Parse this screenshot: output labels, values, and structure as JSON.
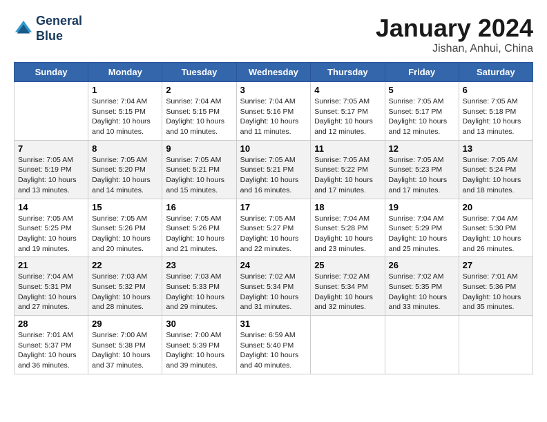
{
  "header": {
    "logo_line1": "General",
    "logo_line2": "Blue",
    "title": "January 2024",
    "subtitle": "Jishan, Anhui, China"
  },
  "days_of_week": [
    "Sunday",
    "Monday",
    "Tuesday",
    "Wednesday",
    "Thursday",
    "Friday",
    "Saturday"
  ],
  "weeks": [
    [
      {
        "date": "",
        "sunrise": "",
        "sunset": "",
        "daylight": ""
      },
      {
        "date": "1",
        "sunrise": "Sunrise: 7:04 AM",
        "sunset": "Sunset: 5:15 PM",
        "daylight": "Daylight: 10 hours and 10 minutes."
      },
      {
        "date": "2",
        "sunrise": "Sunrise: 7:04 AM",
        "sunset": "Sunset: 5:15 PM",
        "daylight": "Daylight: 10 hours and 10 minutes."
      },
      {
        "date": "3",
        "sunrise": "Sunrise: 7:04 AM",
        "sunset": "Sunset: 5:16 PM",
        "daylight": "Daylight: 10 hours and 11 minutes."
      },
      {
        "date": "4",
        "sunrise": "Sunrise: 7:05 AM",
        "sunset": "Sunset: 5:17 PM",
        "daylight": "Daylight: 10 hours and 12 minutes."
      },
      {
        "date": "5",
        "sunrise": "Sunrise: 7:05 AM",
        "sunset": "Sunset: 5:17 PM",
        "daylight": "Daylight: 10 hours and 12 minutes."
      },
      {
        "date": "6",
        "sunrise": "Sunrise: 7:05 AM",
        "sunset": "Sunset: 5:18 PM",
        "daylight": "Daylight: 10 hours and 13 minutes."
      }
    ],
    [
      {
        "date": "7",
        "sunrise": "Sunrise: 7:05 AM",
        "sunset": "Sunset: 5:19 PM",
        "daylight": "Daylight: 10 hours and 13 minutes."
      },
      {
        "date": "8",
        "sunrise": "Sunrise: 7:05 AM",
        "sunset": "Sunset: 5:20 PM",
        "daylight": "Daylight: 10 hours and 14 minutes."
      },
      {
        "date": "9",
        "sunrise": "Sunrise: 7:05 AM",
        "sunset": "Sunset: 5:21 PM",
        "daylight": "Daylight: 10 hours and 15 minutes."
      },
      {
        "date": "10",
        "sunrise": "Sunrise: 7:05 AM",
        "sunset": "Sunset: 5:21 PM",
        "daylight": "Daylight: 10 hours and 16 minutes."
      },
      {
        "date": "11",
        "sunrise": "Sunrise: 7:05 AM",
        "sunset": "Sunset: 5:22 PM",
        "daylight": "Daylight: 10 hours and 17 minutes."
      },
      {
        "date": "12",
        "sunrise": "Sunrise: 7:05 AM",
        "sunset": "Sunset: 5:23 PM",
        "daylight": "Daylight: 10 hours and 17 minutes."
      },
      {
        "date": "13",
        "sunrise": "Sunrise: 7:05 AM",
        "sunset": "Sunset: 5:24 PM",
        "daylight": "Daylight: 10 hours and 18 minutes."
      }
    ],
    [
      {
        "date": "14",
        "sunrise": "Sunrise: 7:05 AM",
        "sunset": "Sunset: 5:25 PM",
        "daylight": "Daylight: 10 hours and 19 minutes."
      },
      {
        "date": "15",
        "sunrise": "Sunrise: 7:05 AM",
        "sunset": "Sunset: 5:26 PM",
        "daylight": "Daylight: 10 hours and 20 minutes."
      },
      {
        "date": "16",
        "sunrise": "Sunrise: 7:05 AM",
        "sunset": "Sunset: 5:26 PM",
        "daylight": "Daylight: 10 hours and 21 minutes."
      },
      {
        "date": "17",
        "sunrise": "Sunrise: 7:05 AM",
        "sunset": "Sunset: 5:27 PM",
        "daylight": "Daylight: 10 hours and 22 minutes."
      },
      {
        "date": "18",
        "sunrise": "Sunrise: 7:04 AM",
        "sunset": "Sunset: 5:28 PM",
        "daylight": "Daylight: 10 hours and 23 minutes."
      },
      {
        "date": "19",
        "sunrise": "Sunrise: 7:04 AM",
        "sunset": "Sunset: 5:29 PM",
        "daylight": "Daylight: 10 hours and 25 minutes."
      },
      {
        "date": "20",
        "sunrise": "Sunrise: 7:04 AM",
        "sunset": "Sunset: 5:30 PM",
        "daylight": "Daylight: 10 hours and 26 minutes."
      }
    ],
    [
      {
        "date": "21",
        "sunrise": "Sunrise: 7:04 AM",
        "sunset": "Sunset: 5:31 PM",
        "daylight": "Daylight: 10 hours and 27 minutes."
      },
      {
        "date": "22",
        "sunrise": "Sunrise: 7:03 AM",
        "sunset": "Sunset: 5:32 PM",
        "daylight": "Daylight: 10 hours and 28 minutes."
      },
      {
        "date": "23",
        "sunrise": "Sunrise: 7:03 AM",
        "sunset": "Sunset: 5:33 PM",
        "daylight": "Daylight: 10 hours and 29 minutes."
      },
      {
        "date": "24",
        "sunrise": "Sunrise: 7:02 AM",
        "sunset": "Sunset: 5:34 PM",
        "daylight": "Daylight: 10 hours and 31 minutes."
      },
      {
        "date": "25",
        "sunrise": "Sunrise: 7:02 AM",
        "sunset": "Sunset: 5:34 PM",
        "daylight": "Daylight: 10 hours and 32 minutes."
      },
      {
        "date": "26",
        "sunrise": "Sunrise: 7:02 AM",
        "sunset": "Sunset: 5:35 PM",
        "daylight": "Daylight: 10 hours and 33 minutes."
      },
      {
        "date": "27",
        "sunrise": "Sunrise: 7:01 AM",
        "sunset": "Sunset: 5:36 PM",
        "daylight": "Daylight: 10 hours and 35 minutes."
      }
    ],
    [
      {
        "date": "28",
        "sunrise": "Sunrise: 7:01 AM",
        "sunset": "Sunset: 5:37 PM",
        "daylight": "Daylight: 10 hours and 36 minutes."
      },
      {
        "date": "29",
        "sunrise": "Sunrise: 7:00 AM",
        "sunset": "Sunset: 5:38 PM",
        "daylight": "Daylight: 10 hours and 37 minutes."
      },
      {
        "date": "30",
        "sunrise": "Sunrise: 7:00 AM",
        "sunset": "Sunset: 5:39 PM",
        "daylight": "Daylight: 10 hours and 39 minutes."
      },
      {
        "date": "31",
        "sunrise": "Sunrise: 6:59 AM",
        "sunset": "Sunset: 5:40 PM",
        "daylight": "Daylight: 10 hours and 40 minutes."
      },
      {
        "date": "",
        "sunrise": "",
        "sunset": "",
        "daylight": ""
      },
      {
        "date": "",
        "sunrise": "",
        "sunset": "",
        "daylight": ""
      },
      {
        "date": "",
        "sunrise": "",
        "sunset": "",
        "daylight": ""
      }
    ]
  ]
}
